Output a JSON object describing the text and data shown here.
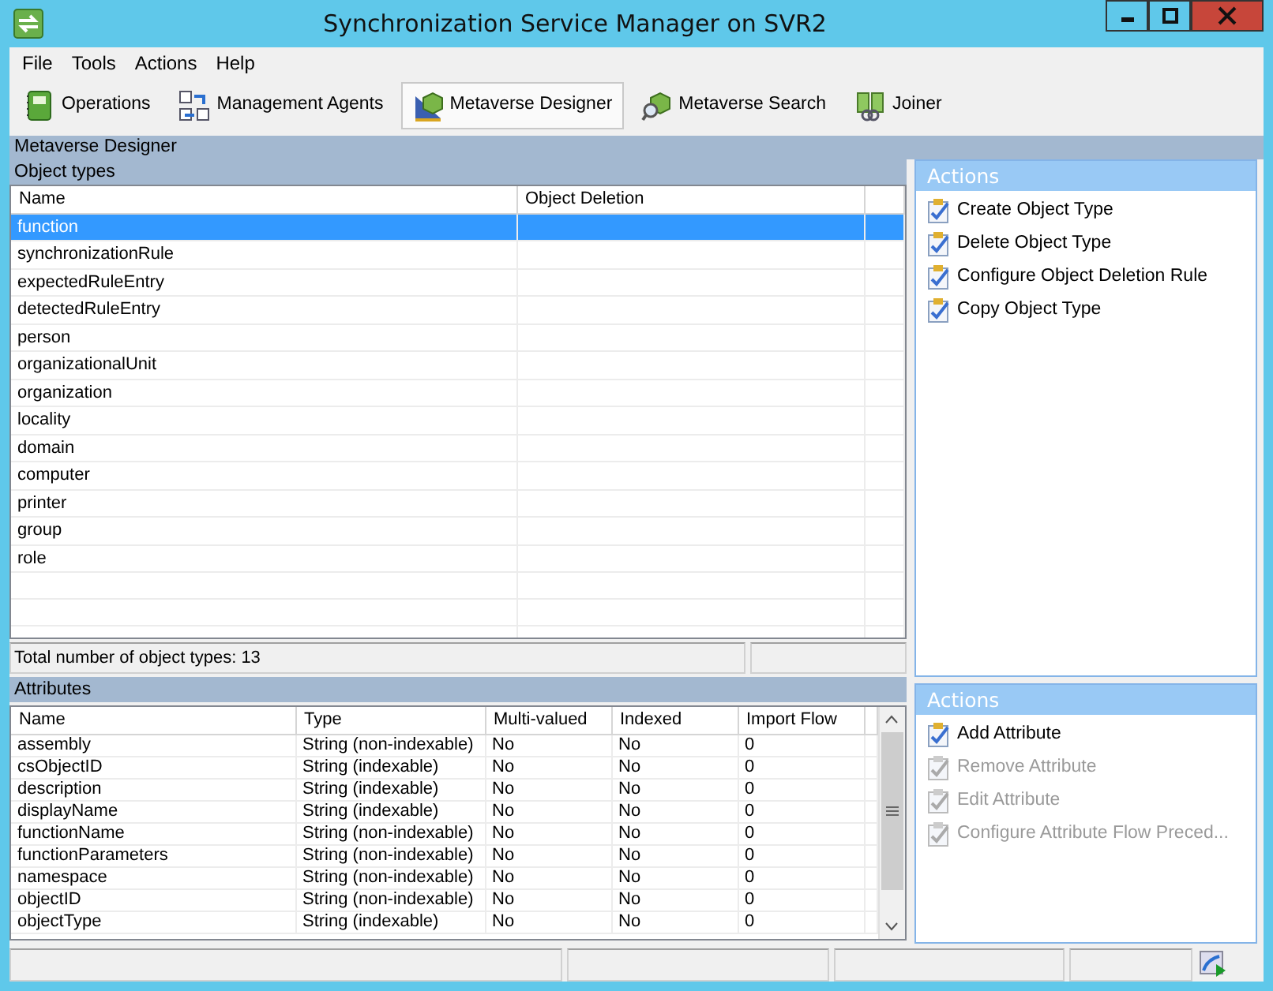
{
  "window": {
    "title": "Synchronization Service Manager on SVR2"
  },
  "menu": [
    "File",
    "Tools",
    "Actions",
    "Help"
  ],
  "toolbar": [
    {
      "label": "Operations",
      "kind": "book",
      "selected": false
    },
    {
      "label": "Management Agents",
      "kind": "agents",
      "selected": false
    },
    {
      "label": "Metaverse Designer",
      "kind": "designer",
      "selected": true
    },
    {
      "label": "Metaverse Search",
      "kind": "search",
      "selected": false
    },
    {
      "label": "Joiner",
      "kind": "joiner",
      "selected": false
    }
  ],
  "section_title": "Metaverse Designer",
  "object_types": {
    "title": "Object types",
    "columns": [
      "Name",
      "Object Deletion"
    ],
    "rows": [
      {
        "name": "function",
        "selected": true
      },
      {
        "name": "synchronizationRule",
        "selected": false
      },
      {
        "name": "expectedRuleEntry",
        "selected": false
      },
      {
        "name": "detectedRuleEntry",
        "selected": false
      },
      {
        "name": "person",
        "selected": false
      },
      {
        "name": "organizationalUnit",
        "selected": false
      },
      {
        "name": "organization",
        "selected": false
      },
      {
        "name": "locality",
        "selected": false
      },
      {
        "name": "domain",
        "selected": false
      },
      {
        "name": "computer",
        "selected": false
      },
      {
        "name": "printer",
        "selected": false
      },
      {
        "name": "group",
        "selected": false
      },
      {
        "name": "role",
        "selected": false
      }
    ],
    "footer": "Total number of object types: 13"
  },
  "object_actions": {
    "title": "Actions",
    "items": [
      {
        "label": "Create Object Type",
        "disabled": false
      },
      {
        "label": "Delete Object Type",
        "disabled": false
      },
      {
        "label": "Configure Object Deletion Rule",
        "disabled": false
      },
      {
        "label": "Copy Object Type",
        "disabled": false
      }
    ]
  },
  "attributes": {
    "title": "Attributes",
    "columns": [
      "Name",
      "Type",
      "Multi-valued",
      "Indexed",
      "Import Flow"
    ],
    "rows": [
      [
        "assembly",
        "String (non-indexable)",
        "No",
        "No",
        "0"
      ],
      [
        "csObjectID",
        "String (indexable)",
        "No",
        "No",
        "0"
      ],
      [
        "description",
        "String (indexable)",
        "No",
        "No",
        "0"
      ],
      [
        "displayName",
        "String (indexable)",
        "No",
        "No",
        "0"
      ],
      [
        "functionName",
        "String (non-indexable)",
        "No",
        "No",
        "0"
      ],
      [
        "functionParameters",
        "String (non-indexable)",
        "No",
        "No",
        "0"
      ],
      [
        "namespace",
        "String (non-indexable)",
        "No",
        "No",
        "0"
      ],
      [
        "objectID",
        "String (non-indexable)",
        "No",
        "No",
        "0"
      ],
      [
        "objectType",
        "String (indexable)",
        "No",
        "No",
        "0"
      ]
    ]
  },
  "attribute_actions": {
    "title": "Actions",
    "items": [
      {
        "label": "Add Attribute",
        "disabled": false
      },
      {
        "label": "Remove Attribute",
        "disabled": true
      },
      {
        "label": "Edit Attribute",
        "disabled": true
      },
      {
        "label": "Configure Attribute Flow Preced...",
        "disabled": true
      }
    ]
  }
}
